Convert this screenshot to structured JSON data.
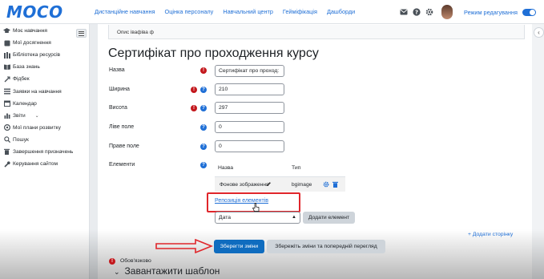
{
  "navbar": {
    "logo_text": "MOCO",
    "links": [
      "Дистанційне навчання",
      "Оцінка персоналу",
      "Навчальний центр",
      "Гейміфікація",
      "Дашборди"
    ],
    "edit_mode_label": "Режим редагування",
    "icons": [
      "mail-icon",
      "help-icon",
      "gear-icon"
    ],
    "accent_color": "#1f6fd6"
  },
  "sidebar": {
    "items": [
      {
        "label": "Моє навчання",
        "icon": "graduation-cap-icon"
      },
      {
        "label": "Мої досягнення",
        "icon": "trophy-icon"
      },
      {
        "label": "Бібліотека ресурсів",
        "icon": "library-icon"
      },
      {
        "label": "База знань",
        "icon": "book-icon"
      },
      {
        "label": "Фідбек",
        "icon": "feedback-icon"
      },
      {
        "label": "Заявки на навчання",
        "icon": "list-icon"
      },
      {
        "label": "Календар",
        "icon": "calendar-icon"
      },
      {
        "label": "Звіти",
        "icon": "chart-icon"
      },
      {
        "label": "Мої плани розвитку",
        "icon": "plan-icon"
      },
      {
        "label": "Пошук",
        "icon": "search-icon"
      },
      {
        "label": "Завершення призначень",
        "icon": "trash-icon"
      },
      {
        "label": "Керування сайтом",
        "icon": "wrench-icon"
      }
    ]
  },
  "main": {
    "description": "Опис івафіва ф",
    "title": "Сертифікат про проходження курсу",
    "fields": {
      "name": {
        "label": "Назва",
        "value": "Сертифікат про проход:"
      },
      "width": {
        "label": "Ширина",
        "value": "210"
      },
      "height": {
        "label": "Висота",
        "value": "297"
      },
      "left_margin": {
        "label": "Ліве поле",
        "value": "0"
      },
      "right_margin": {
        "label": "Праве поле",
        "value": "0"
      },
      "elements": {
        "label": "Елементи"
      }
    },
    "table": {
      "headers": [
        "Назва",
        "Тип"
      ],
      "rows": [
        {
          "name": "Фонове зображення",
          "type": "bgimage"
        }
      ]
    },
    "reposition_link": "Репозиція елементів",
    "element_select": "Дата",
    "add_element_button": "Додати елемент",
    "add_page_link": "+ Додати сторінку",
    "save_button": "Зберегти зміни",
    "save_preview_button": "Збережіть зміни та попередній перегляд",
    "required_note": "Обов'язково",
    "upload_section": "Завантажити шаблон"
  }
}
